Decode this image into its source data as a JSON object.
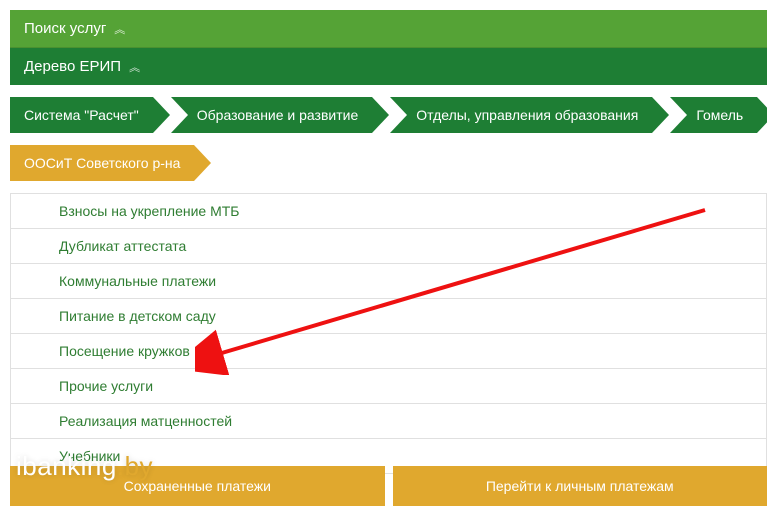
{
  "header": {
    "search": "Поиск услуг",
    "tree": "Дерево ЕРИП"
  },
  "breadcrumb": [
    "Система \"Расчет\"",
    "Образование и развитие",
    "Отделы, управления образования",
    "Гомель"
  ],
  "current": "ООСиТ Советского р-на",
  "services": [
    "Взносы на укрепление МТБ",
    "Дубликат аттестата",
    "Коммунальные платежи",
    "Питание в детском саду",
    "Посещение кружков",
    "Прочие услуги",
    "Реализация матценностей",
    "Учебники"
  ],
  "buttons": {
    "saved": "Сохраненные платежи",
    "personal": "Перейти к личным платежам"
  },
  "watermark": {
    "a": "ibanking",
    "b": ".by"
  }
}
